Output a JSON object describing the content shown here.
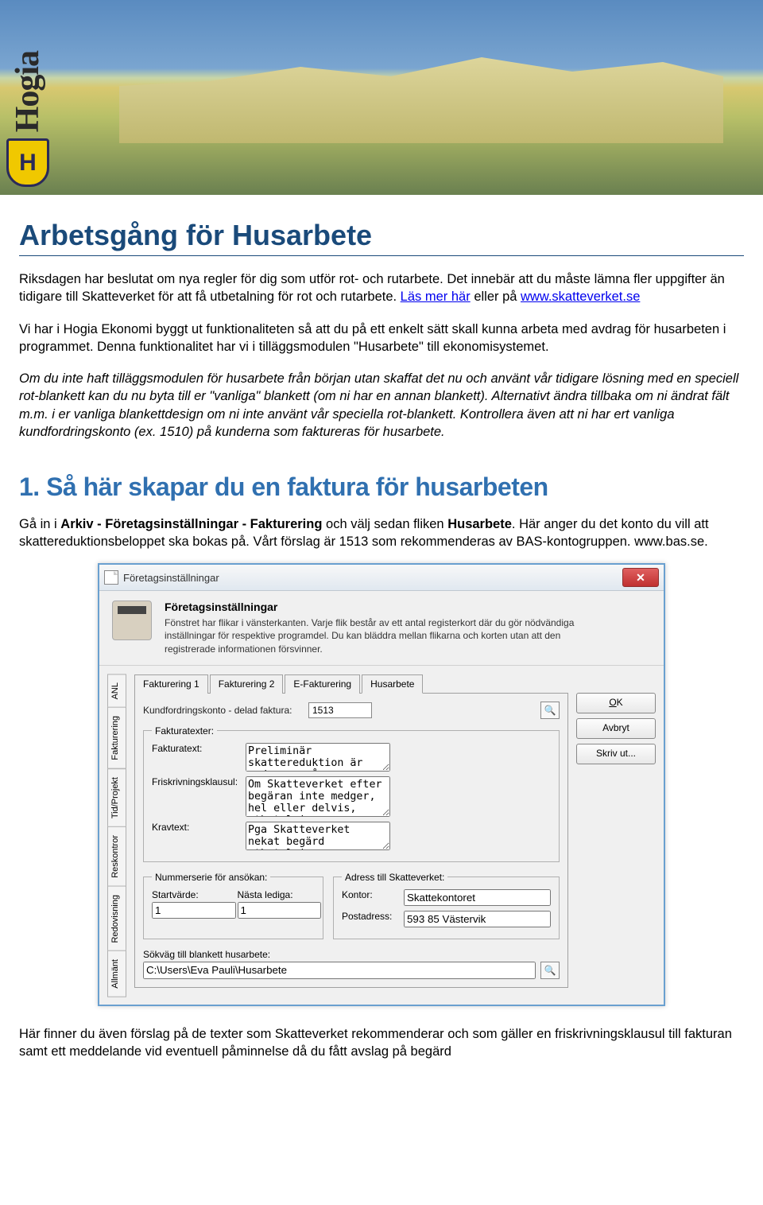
{
  "logo": {
    "brand": "Hogia",
    "shield": "H"
  },
  "headings": {
    "main": "Arbetsgång för Husarbete",
    "section1_num": "1. ",
    "section1_title": "Så här skapar du en faktura för husarbeten"
  },
  "intro": {
    "text1": "Riksdagen har beslutat om nya regler för dig som utför rot- och rutarbete. Det innebär att du måste lämna fler uppgifter än tidigare till Skatteverket för att få utbetalning för rot och rutarbete. ",
    "link1_text": "Läs mer här",
    "text2": " eller på ",
    "link2_text": "www.skatteverket.se"
  },
  "body1": "Vi har i Hogia Ekonomi byggt ut funktionaliteten så att du på ett enkelt sätt skall kunna arbeta med avdrag för husarbeten i programmet. Denna funktionalitet har vi i tilläggsmodulen \"Husarbete\" till ekonomisystemet.",
  "body2": "Om du inte haft tilläggsmodulen för husarbete från början utan skaffat det nu och använt vår tidigare lösning med en speciell rot-blankett kan du nu byta till er \"vanliga\" blankett (om ni har en annan blankett). Alternativt ändra tillbaka om ni ändrat fält m.m. i er vanliga blankettdesign om ni inte använt vår speciella rot-blankett. Kontrollera även att ni har ert vanliga kundfordringskonto (ex. 1510) på kunderna som faktureras för husarbete.",
  "section1_lead_pre": "Gå in i ",
  "section1_lead_bold": "Arkiv - Företagsinställningar - Fakturering",
  "section1_lead_mid": " och välj sedan fliken ",
  "section1_lead_bold2": "Husarbete",
  "section1_lead_post": ". Här anger du det konto du vill att skattereduktionsbeloppet ska bokas på. Vårt förslag är 1513 som rekommenderas av BAS-kontogruppen. www.bas.se.",
  "dialog": {
    "window_title": "Företagsinställningar",
    "header_title": "Företagsinställningar",
    "header_desc": "Fönstret har flikar i vänsterkanten. Varje flik består av ett antal registerkort där du gör nödvändiga inställningar för respektive programdel. Du kan bläddra mellan flikarna och korten utan att den registrerade informationen försvinner.",
    "vtabs": [
      "ANL",
      "Fakturering",
      "Tid/Projekt",
      "Reskontror",
      "Redovisning",
      "Allmänt"
    ],
    "htabs": [
      "Fakturering 1",
      "Fakturering 2",
      "E-Fakturering",
      "Husarbete"
    ],
    "kundfordring_label": "Kundfordringskonto - delad faktura:",
    "kundfordring_value": "1513",
    "fakturatexter_legend": "Fakturatexter:",
    "fakturatext_label": "Fakturatext:",
    "fakturatext_value": "Preliminär skattereduktion är avdragen på arbetskostnaden med:",
    "friskrivning_label": "Friskrivningsklausul:",
    "friskrivning_value": "Om Skatteverket efter begäran inte medger, hel eller delvis, utbetalning av skattereduktion, äger Vi rätt att omgående fakturera Er återstående del av arbetskostnaden.",
    "kravtext_label": "Kravtext:",
    "kravtext_value": "Pga Skatteverket nekat begärd utbetalning av preliminär skattereduktion, kräver Vi härmed Er på återstående belopp.",
    "nummerserie_legend": "Nummerserie för ansökan:",
    "startvarde_label": "Startvärde:",
    "startvarde_value": "1",
    "nastalediga_label": "Nästa lediga:",
    "nastalediga_value": "1",
    "adress_legend": "Adress till Skatteverket:",
    "kontor_label": "Kontor:",
    "kontor_value": "Skattekontoret",
    "postadress_label": "Postadress:",
    "postadress_value": "593 85 Västervik",
    "sokvag_label": "Sökväg till blankett husarbete:",
    "sokvag_value": "C:\\Users\\Eva Pauli\\Husarbete",
    "buttons": {
      "ok": "OK",
      "avbryt": "Avbryt",
      "skrivut": "Skriv ut..."
    }
  },
  "footer": "Här finner du även förslag på de texter som Skatteverket rekommenderar och som gäller en friskrivningsklausul till fakturan samt ett meddelande vid eventuell påminnelse då du fått avslag på begärd"
}
